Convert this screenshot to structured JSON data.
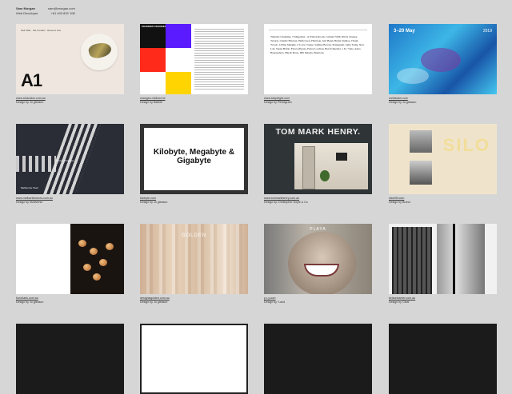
{
  "header": {
    "name": "Sam Morgan",
    "role": "Web Developer",
    "email": "sam@morgan.com",
    "phone": "+61 403 832 108"
  },
  "cards": [
    {
      "url": "www.a1studios.com.au",
      "credit": "Design by Jo gleason",
      "thumb_text": "A1",
      "thumb_sub": "Hair Matt · Set Contact · Reserve Ave"
    },
    {
      "url": "changes.melbourne",
      "credit": "Design by Babble",
      "thumb_text": "CHANGES CHANGES CHANGES 4 & 7 4.6"
    },
    {
      "url": "www.tokyofiglix.com",
      "credit": "Design by Pentagram",
      "thumb_text": "Timothy Chalamet, T Magazine / A Wilson Room, Carhartt WIP, Olivia Cheney, Tavaris, Charlie Ellerton, Halfcrown, Harrison, Girl Band, Home Studios, Thrud, Tovatc, Cillian Murphy, L'Corso Vogue, Samine Bowan, Pentagram, Jamy Tsing, New Lab, Susan Hable, Flores (Egon), Fettes Lorchan, Ben Schneider, 1 D / Vans, Anna Hargreabers, Hip & Draw, DH, Rituals, Brentons"
    },
    {
      "url": "melbswim.com",
      "credit": "Design by Jo gleason",
      "thumb_text": "3–20 May",
      "thumb_sub": "2019"
    },
    {
      "url": "www.melbartlectures.com.au",
      "credit": "Design by Multiverse",
      "thumb_text": "Melbourne Town",
      "thumb_sub": "Arrows Changes"
    },
    {
      "url": "kilobyte.com",
      "credit": "Design by Jo gleason",
      "thumb_text": "Kilobyte, Megabyte & Gigabyte"
    },
    {
      "url": "www.tommarkhenry.com.au",
      "credit": "Design by Christopher Doyle & Co",
      "thumb_text": "TOM MARK HENRY."
    },
    {
      "url": "siloinfill.com",
      "credit": "Design by Brand",
      "thumb_text": "SILO"
    },
    {
      "url": "buroharis.com.au",
      "credit": "Design by Jo gleason",
      "thumb_text": ""
    },
    {
      "url": "designisgolden.com.au",
      "credit": "Design by Jo gleason",
      "thumb_text": "GOLDEN"
    },
    {
      "url": "p-l-y.com",
      "credit": "Design by Y-and",
      "thumb_text": "PLAYA"
    },
    {
      "url": "kelsonbanter.com.au",
      "credit": "Design by Cleat",
      "thumb_text": ""
    }
  ],
  "row4": [
    {
      "label": ""
    },
    {
      "label": ""
    },
    {
      "label": ""
    },
    {
      "label": ""
    }
  ]
}
